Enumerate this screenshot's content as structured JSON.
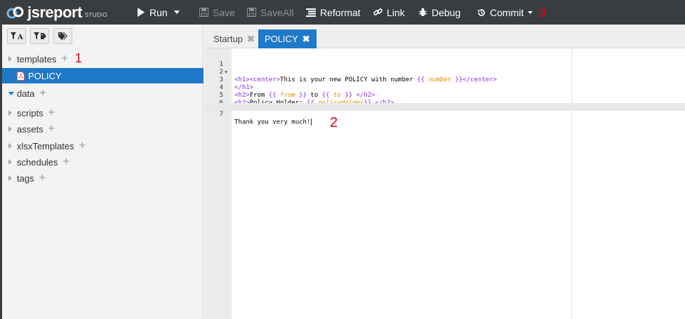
{
  "app": {
    "logo_text": "jsreport",
    "logo_sub": "STUDIO"
  },
  "toolbar": {
    "run": "Run",
    "save": "Save",
    "save_all": "SaveAll",
    "reformat": "Reformat",
    "link": "Link",
    "debug": "Debug",
    "commit": "Commit"
  },
  "annotations": {
    "one": "1",
    "two": "2",
    "three": "3"
  },
  "sidebar": {
    "items": [
      {
        "label": "templates",
        "expanded": false,
        "has_plus": true
      },
      {
        "label": "POLICY",
        "selected": true,
        "icon": "pdf-icon"
      },
      {
        "label": "data",
        "expanded": true,
        "has_plus": true
      },
      {
        "label": "scripts",
        "expanded": false,
        "has_plus": true
      },
      {
        "label": "assets",
        "expanded": false,
        "has_plus": true
      },
      {
        "label": "xlsxTemplates",
        "expanded": false,
        "has_plus": true
      },
      {
        "label": "schedules",
        "expanded": false,
        "has_plus": true
      },
      {
        "label": "tags",
        "expanded": false,
        "has_plus": true
      }
    ]
  },
  "tabs": [
    {
      "label": "Startup",
      "active": false
    },
    {
      "label": "POLICY",
      "active": true
    }
  ],
  "editor": {
    "lines": [
      {
        "num": "1",
        "text": "<h1>"
      },
      {
        "num": "2",
        "text": "    <center>This is your new POLICY with number {{ number }}</center>"
      },
      {
        "num": "3",
        "text": "</h1>"
      },
      {
        "num": "4",
        "text": "<h2>From {{ from }} to {{ to }} </h2>"
      },
      {
        "num": "5",
        "text": "<h2>Policy Holder: {{ policyHolder}} </h2>"
      },
      {
        "num": "6",
        "text": ""
      },
      {
        "num": "7",
        "text": "Thank you very much!"
      }
    ],
    "parts": {
      "l1_tag": "<h1>",
      "l2_indent": "    ",
      "l2_open": "<center>",
      "l2_text": "This is your new POLICY with number ",
      "l2_mo": "{{",
      "l2_var": "number",
      "l2_mc": "}}",
      "l2_close": "</center>",
      "l3_tag": "</h1>",
      "l4_open": "<h2>",
      "l4_t1": "From ",
      "l4_mo1": "{{",
      "l4_v1": "from",
      "l4_mc1": "}}",
      "l4_t2": " to ",
      "l4_mo2": "{{",
      "l4_v2": "to",
      "l4_mc2": "}}",
      "l4_close": "</h2>",
      "l5_open": "<h2>",
      "l5_t1": "Policy Holder: ",
      "l5_mo": "{{",
      "l5_var": "policyHolder",
      "l5_mc": "}}",
      "l5_close": "</h2>",
      "l7_text": "Thank you very much!"
    }
  },
  "colors": {
    "toolbar_bg": "#3a3d40",
    "accent": "#1f79c9",
    "annotation_red": "#e0001b",
    "tag_purple": "#8a2be2",
    "variable_orange": "#e58c00"
  }
}
